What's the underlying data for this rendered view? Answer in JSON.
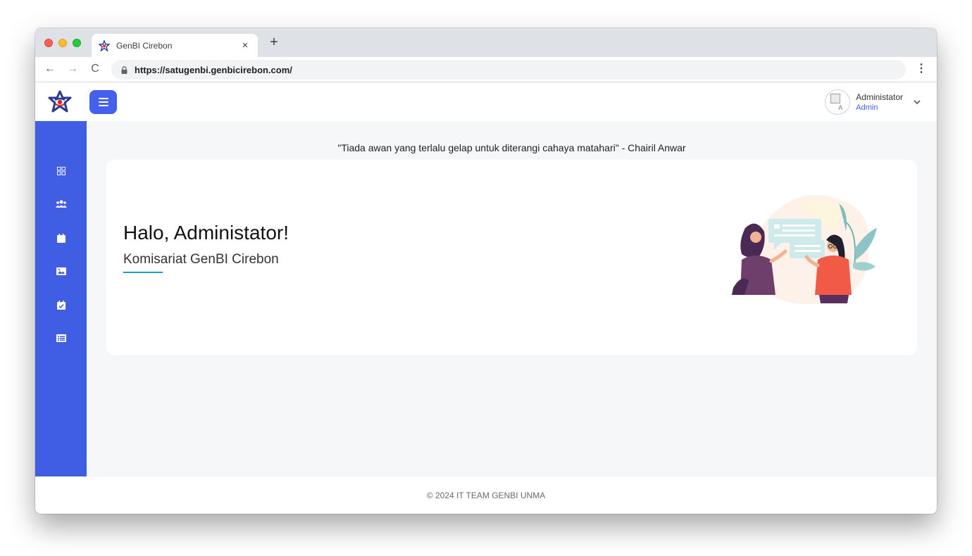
{
  "browser": {
    "tab_title": "GenBI Cirebon",
    "tab_close": "×",
    "new_tab": "+",
    "back": "←",
    "forward": "→",
    "reload": "C",
    "url": "https://satugenbi.genbicirebon.com/",
    "menu": "⋮"
  },
  "header": {
    "user_name": "Administator",
    "user_role": "Admin",
    "avatar_alt": "A",
    "accent": "#4361ee"
  },
  "sidebar": {
    "color": "#3f5ee3",
    "items": [
      {
        "icon": "dashboard-grid-icon"
      },
      {
        "icon": "users-icon"
      },
      {
        "icon": "calendar-icon"
      },
      {
        "icon": "image-gallery-icon"
      },
      {
        "icon": "calendar-check-icon"
      },
      {
        "icon": "list-card-icon"
      }
    ]
  },
  "main": {
    "quote": "\"Tiada awan yang terlalu gelap untuk diterangi cahaya matahari\" - Chairil Anwar",
    "greeting": "Halo, Administator!",
    "organization": "Komisariat GenBI Cirebon"
  },
  "footer": {
    "text": "© 2024 IT TEAM GENBI UNMA"
  }
}
